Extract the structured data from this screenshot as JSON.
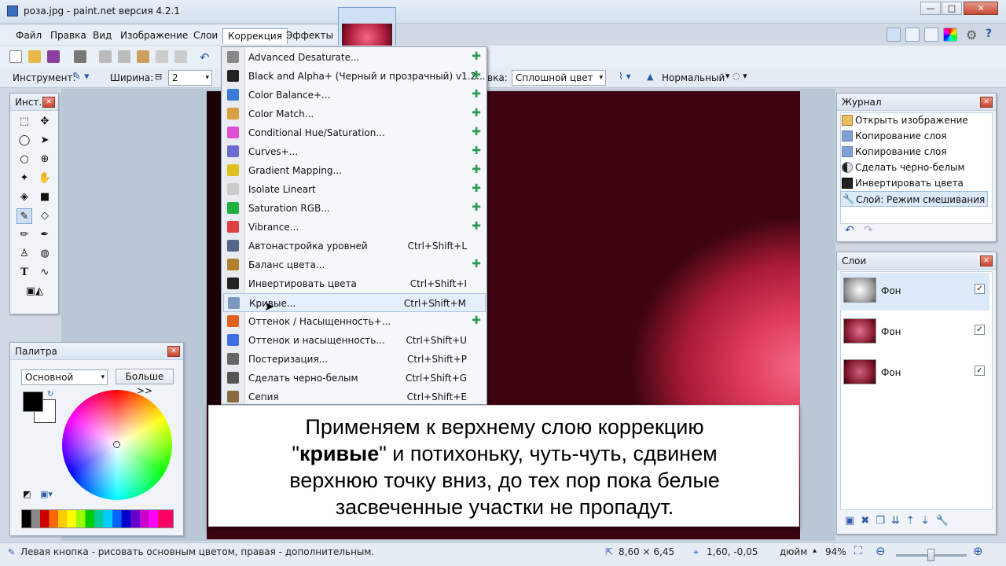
{
  "window": {
    "title": "роза.jpg - paint.net версия 4.2.1",
    "minimize": "—",
    "maximize": "□",
    "close": "✕"
  },
  "menubar": [
    "Файл",
    "Правка",
    "Вид",
    "Изображение",
    "Слои",
    "Коррекция",
    "Эффекты"
  ],
  "toolbar2": {
    "instrument_label": "Инструмент:",
    "width_label": "Ширина:",
    "width_value": "2",
    "fill_label": "вка:",
    "fill_value": "Сплошной цвет",
    "blend_value": "Нормальный"
  },
  "adjustments_menu": [
    {
      "label": "Advanced Desaturate...",
      "shortcut": "",
      "plugin": true,
      "color": "#888888"
    },
    {
      "label": "Black and Alpha+ (Черный и прозрачный) v1.2...",
      "shortcut": "",
      "plugin": true,
      "color": "#222222"
    },
    {
      "label": "Color Balance+...",
      "shortcut": "",
      "plugin": true,
      "color": "#3a7ad8"
    },
    {
      "label": "Color Match...",
      "shortcut": "",
      "plugin": true,
      "color": "#d8a040"
    },
    {
      "label": "Conditional Hue/Saturation...",
      "shortcut": "",
      "plugin": true,
      "color": "#e04fd0"
    },
    {
      "label": "Curves+...",
      "shortcut": "",
      "plugin": true,
      "color": "#6a6ad0"
    },
    {
      "label": "Gradient Mapping...",
      "shortcut": "",
      "plugin": true,
      "color": "#e0c020"
    },
    {
      "label": "Isolate Lineart",
      "shortcut": "",
      "plugin": true,
      "color": "#cccccc"
    },
    {
      "label": "Saturation RGB...",
      "shortcut": "",
      "plugin": true,
      "color": "#20b040"
    },
    {
      "label": "Vibrance...",
      "shortcut": "",
      "plugin": true,
      "color": "#e04040"
    },
    {
      "label": "Автонастройка уровней",
      "shortcut": "Ctrl+Shift+L",
      "plugin": false,
      "color": "#556688"
    },
    {
      "label": "Баланс цвета...",
      "shortcut": "",
      "plugin": true,
      "color": "#b08030"
    },
    {
      "label": "Инвертировать цвета",
      "shortcut": "Ctrl+Shift+I",
      "plugin": false,
      "color": "#222222"
    },
    {
      "label": "Кривые...",
      "shortcut": "Ctrl+Shift+M",
      "plugin": false,
      "color": "#7a98c0"
    },
    {
      "label": "Оттенок / Насыщенность+...",
      "shortcut": "",
      "plugin": true,
      "color": "#e06020"
    },
    {
      "label": "Оттенок и насыщенность...",
      "shortcut": "Ctrl+Shift+U",
      "plugin": false,
      "color": "#4070e0"
    },
    {
      "label": "Постеризация...",
      "shortcut": "Ctrl+Shift+P",
      "plugin": false,
      "color": "#666666"
    },
    {
      "label": "Сделать черно-белым",
      "shortcut": "Ctrl+Shift+G",
      "plugin": false,
      "color": "#555555"
    },
    {
      "label": "Сепия",
      "shortcut": "Ctrl+Shift+E",
      "plugin": false,
      "color": "#8a6a40"
    }
  ],
  "tools_panel": {
    "title": "Инст..."
  },
  "palette_panel": {
    "title": "Палитра",
    "mode": "Основной",
    "more_button": "Больше >>"
  },
  "history_panel": {
    "title": "Журнал",
    "items": [
      "Открыть изображение",
      "Копирование слоя",
      "Копирование слоя",
      "Сделать черно-белым",
      "Инвертировать цвета",
      "Слой: Режим смешивания"
    ]
  },
  "layers_panel": {
    "title": "Слои",
    "layers": [
      "Фон",
      "Фон",
      "Фон"
    ]
  },
  "caption": {
    "line1": "Применяем к верхнему слою коррекцию",
    "q_open": "\"",
    "bold": "кривые",
    "q_rest": "\" и потихоньку, чуть-чуть, сдвинем",
    "line3": "верхнюю точку вниз, до тех пор пока белые",
    "line4": "засвеченные участки не пропадут."
  },
  "statusbar": {
    "hint": "Левая кнопка - рисовать основным цветом, правая - дополнительным.",
    "size": "8,60 × 6,45",
    "coords": "1,60, -0,05",
    "units": "дюйм",
    "zoom": "94%"
  },
  "accent_colors": {
    "primary": "#000000",
    "secondary": "#ffffff"
  }
}
